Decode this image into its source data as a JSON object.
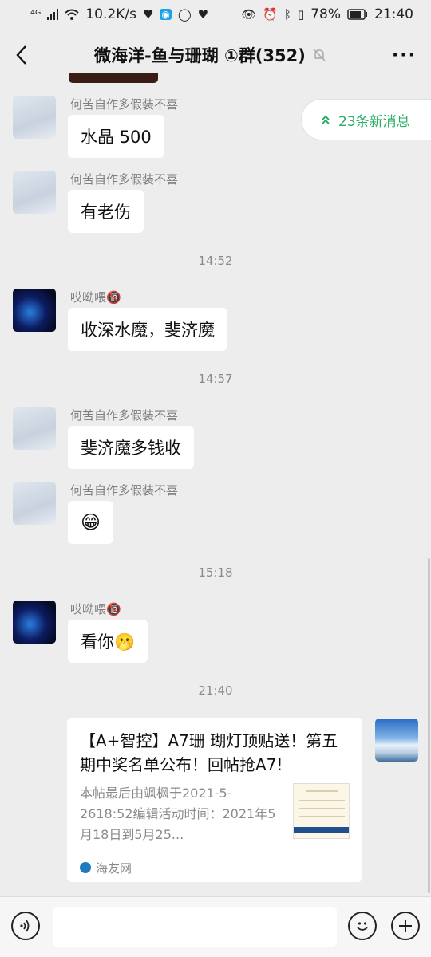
{
  "status_bar": {
    "network": "⁴ᴳ",
    "speed": "10.2K/s",
    "battery": "78%",
    "time": "21:40"
  },
  "header": {
    "title": "微海洋-鱼与珊瑚 ①群(352)",
    "mute_icon": "bell-off-icon",
    "more": "···"
  },
  "new_messages_pill": {
    "label": "23条新消息",
    "icon": "double-chevron-up-icon",
    "color": "#2aae67"
  },
  "messages": [
    {
      "sender": "何苦自作多假装不喜",
      "text": "水晶 500",
      "avatar": "light"
    },
    {
      "sender": "何苦自作多假装不喜",
      "text": "有老伤",
      "avatar": "light"
    },
    {
      "timestamp": "14:52"
    },
    {
      "sender": "哎呦喂🔞",
      "text": "收深水魔，斐济魔",
      "avatar": "dark"
    },
    {
      "timestamp": "14:57"
    },
    {
      "sender": "何苦自作多假装不喜",
      "text": "斐济魔多钱收",
      "avatar": "light"
    },
    {
      "sender": "何苦自作多假装不喜",
      "text": "😁",
      "avatar": "light"
    },
    {
      "timestamp": "15:18"
    },
    {
      "sender": "哎呦喂🔞",
      "text": "看你🫢",
      "avatar": "dark"
    },
    {
      "timestamp": "21:40"
    }
  ],
  "link_card": {
    "title": "【A+智控】A7珊 瑚灯顶贴送！第五期中奖名单公布！回帖抢A7!",
    "description": "本帖最后由飒枫于2021-5-2618:52编辑活动时间：2021年5月18日到5月25...",
    "source": "海友网"
  },
  "input_bar": {
    "voice_icon": "voice-icon",
    "emoji_icon": "emoji-icon",
    "plus_icon": "plus-icon"
  }
}
